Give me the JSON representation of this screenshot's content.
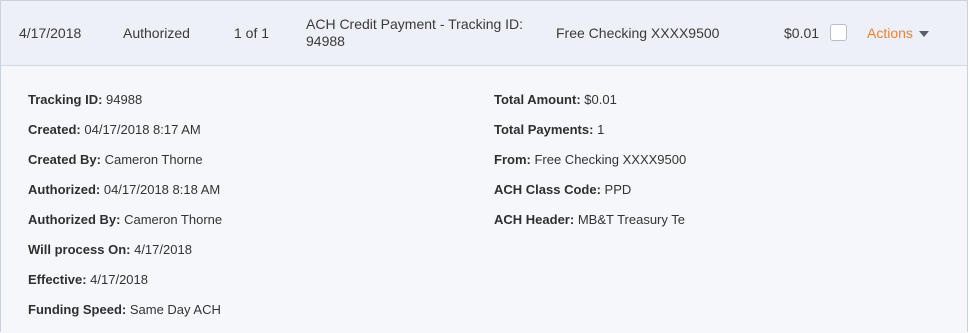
{
  "summary": {
    "date": "4/17/2018",
    "status": "Authorized",
    "count": "1 of 1",
    "description": "ACH Credit Payment - Tracking ID: 94988",
    "account": "Free Checking XXXX9500",
    "amount": "$0.01",
    "actions_label": "Actions",
    "actions_icon": "caret-down-icon",
    "accent_color": "#e8833a"
  },
  "details": {
    "left": [
      {
        "label": "Tracking ID:",
        "value": "94988"
      },
      {
        "label": "Created:",
        "value": "04/17/2018 8:17 AM"
      },
      {
        "label": "Created By:",
        "value": "Cameron Thorne"
      },
      {
        "label": "Authorized:",
        "value": "04/17/2018 8:18 AM"
      },
      {
        "label": "Authorized By:",
        "value": "Cameron Thorne"
      },
      {
        "label": "Will process On:",
        "value": "4/17/2018"
      },
      {
        "label": "Effective:",
        "value": "4/17/2018"
      },
      {
        "label": "Funding Speed:",
        "value": "Same Day ACH"
      }
    ],
    "right": [
      {
        "label": "Total Amount:",
        "value": "$0.01"
      },
      {
        "label": "Total Payments:",
        "value": "1"
      },
      {
        "label": "From:",
        "value": "Free Checking XXXX9500"
      },
      {
        "label": "ACH Class Code:",
        "value": "PPD"
      },
      {
        "label": "ACH Header:",
        "value": "MB&T Treasury Te"
      }
    ]
  }
}
